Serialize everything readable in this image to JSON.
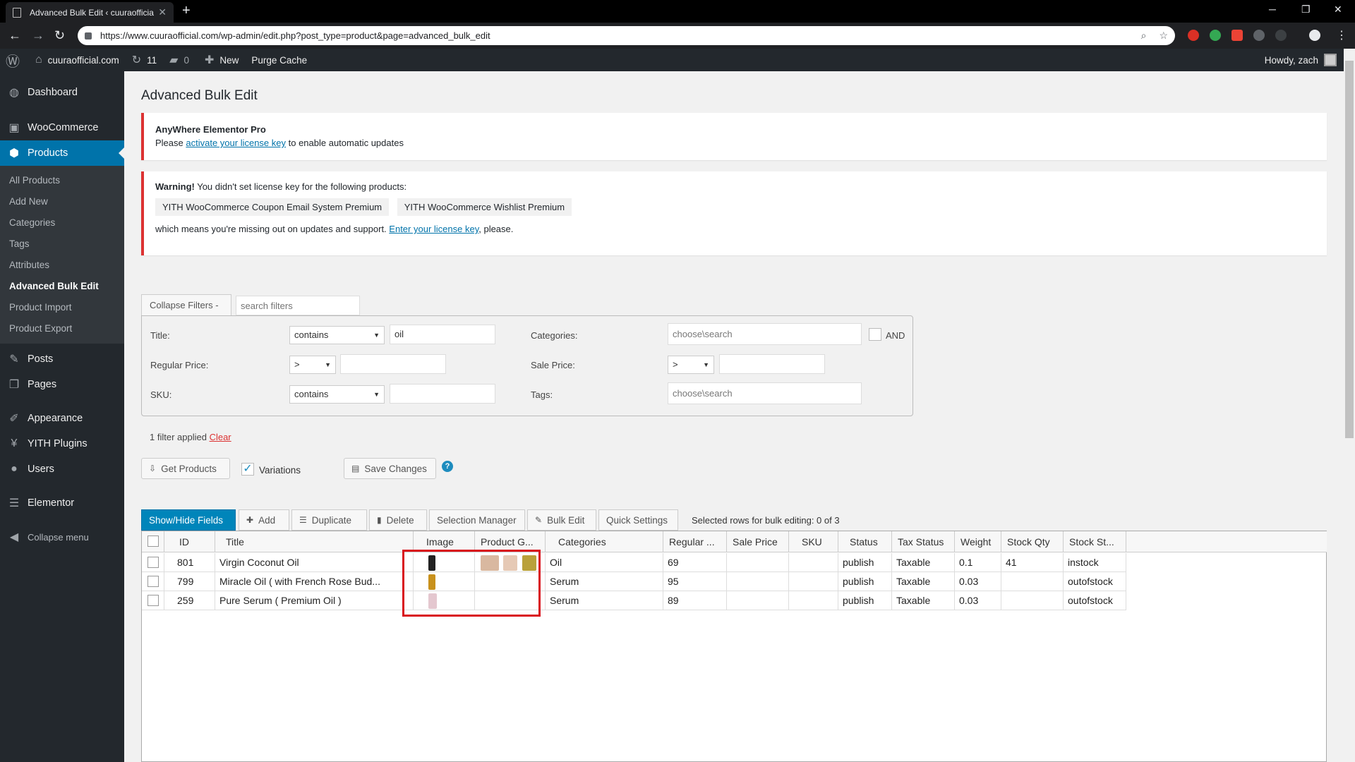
{
  "browser": {
    "tab_title": "Advanced Bulk Edit ‹ cuuraofficial",
    "url": "https://www.cuuraofficial.com/wp-admin/edit.php?post_type=product&page=advanced_bulk_edit"
  },
  "adminbar": {
    "site_name": "cuuraofficial.com",
    "updates_count": "11",
    "comments_count": "0",
    "new_label": "New",
    "purge_label": "Purge Cache",
    "howdy": "Howdy, zach"
  },
  "sidebar": {
    "dashboard": "Dashboard",
    "woocommerce": "WooCommerce",
    "products": "Products",
    "sub": [
      "All Products",
      "Add New",
      "Categories",
      "Tags",
      "Attributes",
      "Advanced Bulk Edit",
      "Product Import",
      "Product Export"
    ],
    "posts": "Posts",
    "pages": "Pages",
    "appearance": "Appearance",
    "yith": "YITH Plugins",
    "users": "Users",
    "elementor": "Elementor",
    "collapse": "Collapse menu"
  },
  "page": {
    "title": "Advanced Bulk Edit"
  },
  "notice1": {
    "heading": "AnyWhere Elementor Pro",
    "text_before": "Please ",
    "link": "activate your license key",
    "text_after": " to enable automatic updates"
  },
  "notice2": {
    "warning": "Warning!",
    "text": " You didn't set license key for the following products:",
    "products": [
      "YITH WooCommerce Coupon Email System Premium",
      "YITH WooCommerce Wishlist Premium"
    ],
    "text2": "which means you're missing out on updates and support. ",
    "link": "Enter your license key",
    "text3": ", please."
  },
  "filters": {
    "collapse_label": "Collapse Filters -",
    "search_placeholder": "search filters",
    "title_label": "Title:",
    "title_op": "contains",
    "title_value": "oil",
    "regular_price_label": "Regular Price:",
    "regular_price_op": ">",
    "sku_label": "SKU:",
    "sku_op": "contains",
    "categories_label": "Categories:",
    "categories_placeholder": "choose\\search",
    "and_label": "AND",
    "sale_price_label": "Sale Price:",
    "sale_price_op": ">",
    "tags_label": "Tags:",
    "tags_placeholder": "choose\\search",
    "status_text": "1 filter applied ",
    "clear": "Clear"
  },
  "actions": {
    "get_products": "Get Products",
    "variations": "Variations",
    "save_changes": "Save Changes",
    "help": "?"
  },
  "grid_toolbar": {
    "show_hide": "Show/Hide Fields",
    "add": "Add",
    "duplicate": "Duplicate",
    "delete": "Delete",
    "selection_manager": "Selection Manager",
    "bulk_edit": "Bulk Edit",
    "quick_settings": "Quick Settings",
    "selected_text": "Selected rows for bulk editing:  0 of 3"
  },
  "grid": {
    "columns": [
      "ID",
      "Title",
      "Image",
      "Product G...",
      "Categories",
      "Regular ...",
      "Sale Price",
      "SKU",
      "Status",
      "Tax Status",
      "Weight",
      "Stock Qty",
      "Stock St..."
    ],
    "rows": [
      {
        "id": "801",
        "title": "Virgin Coconut Oil",
        "category": "Oil",
        "regular": "69",
        "sale": "",
        "sku": "",
        "status": "publish",
        "tax": "Taxable",
        "weight": "0.1",
        "qty": "41",
        "stock": "instock"
      },
      {
        "id": "799",
        "title": "Miracle Oil ( with French Rose Bud...",
        "category": "Serum",
        "regular": "95",
        "sale": "",
        "sku": "",
        "status": "publish",
        "tax": "Taxable",
        "weight": "0.03",
        "qty": "",
        "stock": "outofstock"
      },
      {
        "id": "259",
        "title": "Pure Serum ( Premium Oil )",
        "category": "Serum",
        "regular": "89",
        "sale": "",
        "sku": "",
        "status": "publish",
        "tax": "Taxable",
        "weight": "0.03",
        "qty": "",
        "stock": "outofstock"
      }
    ]
  },
  "colors": {
    "wp_blue": "#0073aa",
    "admin_dark": "#23282d",
    "highlight_red": "#d9111b"
  }
}
